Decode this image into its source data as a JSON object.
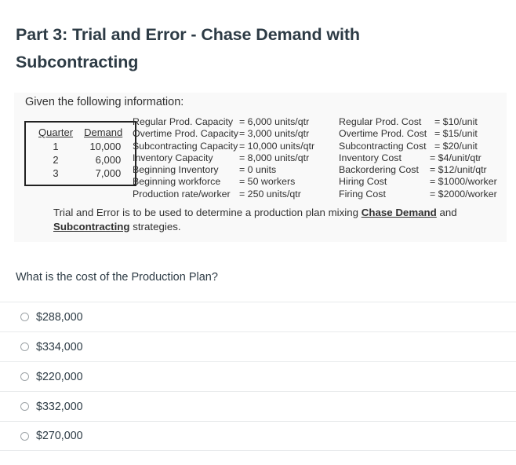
{
  "page": {
    "title": "Part 3: Trial and Error - Chase Demand with Subcontracting"
  },
  "problem": {
    "given_heading": "Given the following information:",
    "demand_table": {
      "headers": [
        "Quarter",
        "Demand"
      ],
      "rows": [
        {
          "quarter": "1",
          "demand": "10,000"
        },
        {
          "quarter": "2",
          "demand": "6,000"
        },
        {
          "quarter": "3",
          "demand": "7,000"
        }
      ]
    },
    "capacity_params": [
      {
        "label": "Regular Prod. Capacity",
        "value": "= 6,000 units/qtr"
      },
      {
        "label": "Overtime Prod. Capacity",
        "value": "= 3,000 units/qtr"
      },
      {
        "label": "Subcontracting Capacity",
        "value": "= 10,000 units/qtr"
      },
      {
        "label": "Inventory Capacity",
        "value": "= 8,000 units/qtr"
      },
      {
        "label": "Beginning Inventory",
        "value": "= 0 units"
      },
      {
        "label": "Beginning workforce",
        "value": "= 50 workers"
      },
      {
        "label": "Production rate/worker",
        "value": "= 250 units/qtr"
      }
    ],
    "cost_params": [
      {
        "label": "Regular Prod. Cost",
        "value": "= $10/unit"
      },
      {
        "label": "Overtime Prod. Cost",
        "value": "= $15/unit"
      },
      {
        "label": "Subcontracting Cost",
        "value": "= $20/unit"
      },
      {
        "label": "Inventory Cost",
        "value": "= $4/unit/qtr"
      },
      {
        "label": "Backordering Cost",
        "value": "= $12/unit/qtr"
      },
      {
        "label": "Hiring Cost",
        "value": "= $1000/worker"
      },
      {
        "label": "Firing Cost",
        "value": "= $2000/worker"
      }
    ],
    "instruction": {
      "part1": "Trial and Error is to be used to determine a production plan mixing ",
      "emphasis1": "Chase Demand",
      "part2": " and ",
      "emphasis2": "Subcontracting",
      "part3": " strategies."
    }
  },
  "question": {
    "prompt": "What is the cost of the Production Plan?",
    "options": [
      {
        "label": "$288,000"
      },
      {
        "label": "$334,000"
      },
      {
        "label": "$220,000"
      },
      {
        "label": "$332,000"
      },
      {
        "label": "$270,000"
      }
    ]
  }
}
